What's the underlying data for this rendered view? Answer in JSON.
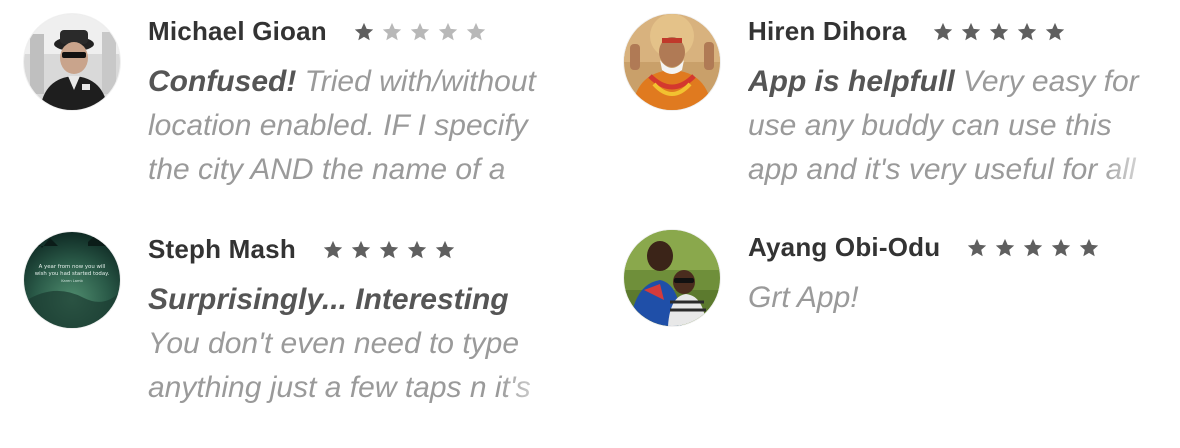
{
  "colors": {
    "star_filled": "#5f5f5f",
    "star_empty": "#b8b8b8",
    "author": "#333333",
    "title": "#555555",
    "body": "#9a9a9a"
  },
  "reviews": [
    {
      "author": "Michael Gioan",
      "rating": 1,
      "max_rating": 5,
      "title": "Confused!",
      "text": "Tried with/without location enabled. IF I specify the city AND the name of a"
    },
    {
      "author": "Hiren Dihora",
      "rating": 5,
      "max_rating": 5,
      "title": "App is helpfull",
      "text": "Very easy for use any buddy can use this app and it's very useful for all"
    },
    {
      "author": "Steph Mash",
      "rating": 5,
      "max_rating": 5,
      "title": "Surprisingly... Interesting",
      "text": "You don't even need to type anything just a few taps n it's",
      "avatar_text": "A year from now you will wish you had started today.",
      "avatar_credit": "Karen Lamb"
    },
    {
      "author": "Ayang Obi-Odu",
      "rating": 5,
      "max_rating": 5,
      "title": "",
      "text": "Grt App!"
    }
  ]
}
